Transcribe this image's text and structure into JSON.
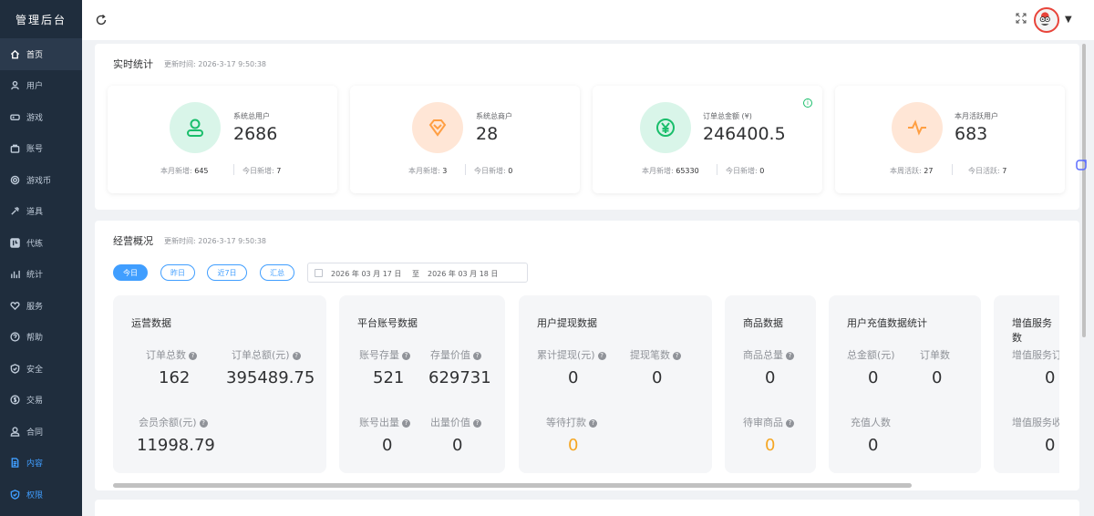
{
  "sidebar": {
    "logo": "管理后台",
    "items": [
      {
        "label": "首页",
        "icon": "home-icon"
      },
      {
        "label": "用户",
        "icon": "user-icon"
      },
      {
        "label": "游戏",
        "icon": "gamepad-icon"
      },
      {
        "label": "账号",
        "icon": "bag-icon"
      },
      {
        "label": "游戏币",
        "icon": "coin-icon"
      },
      {
        "label": "道具",
        "icon": "tool-icon"
      },
      {
        "label": "代练",
        "icon": "grid-icon"
      },
      {
        "label": "统计",
        "icon": "bar-chart-icon"
      },
      {
        "label": "服务",
        "icon": "heart-icon"
      },
      {
        "label": "帮助",
        "icon": "help-icon"
      },
      {
        "label": "安全",
        "icon": "shield-icon"
      },
      {
        "label": "交易",
        "icon": "dollar-icon"
      },
      {
        "label": "合同",
        "icon": "person-icon"
      },
      {
        "label": "内容",
        "icon": "document-icon"
      },
      {
        "label": "权限",
        "icon": "shield-check-icon"
      }
    ]
  },
  "realtime": {
    "title": "实时统计",
    "updated": "更新时间: 2026-3-17 9:50:38",
    "cards": [
      {
        "label": "系统总用户",
        "value": "2686",
        "foot1_label": "本月新增:",
        "foot1_value": "645",
        "foot2_label": "今日新增:",
        "foot2_value": "7",
        "icon": "user-icon",
        "color": "#19be6b"
      },
      {
        "label": "系统总商户",
        "value": "28",
        "foot1_label": "本月新增:",
        "foot1_value": "3",
        "foot2_label": "今日新增:",
        "foot2_value": "0",
        "icon": "diamond-icon",
        "color": "#ff9f43"
      },
      {
        "label": "订单总金额 (¥)",
        "value": "246400.5",
        "foot1_label": "本月新增:",
        "foot1_value": "65330",
        "foot2_label": "今日新增:",
        "foot2_value": "0",
        "icon": "yen-icon",
        "color": "#19be6b"
      },
      {
        "label": "本月活跃用户",
        "value": "683",
        "foot1_label": "本周活跃:",
        "foot1_value": "27",
        "foot2_label": "今日活跃:",
        "foot2_value": "7",
        "icon": "pulse-icon",
        "color": "#ff9f43"
      }
    ]
  },
  "business": {
    "title": "经营概况",
    "updated": "更新时间: 2026-3-17 9:50:38",
    "tabs": [
      "今日",
      "昨日",
      "近7日",
      "汇总"
    ],
    "date_start": "2026 年 03 月 17 日",
    "date_sep": "至",
    "date_end": "2026 年 03 月 18 日",
    "cards": [
      {
        "title": "运营数据",
        "items": [
          {
            "label": "订单总数",
            "value": "162",
            "help": true
          },
          {
            "label": "订单总额(元)",
            "value": "395489.75",
            "help": true
          },
          {
            "label": "会员余额(元)",
            "value": "11998.79",
            "help": true
          }
        ]
      },
      {
        "title": "平台账号数据",
        "items": [
          {
            "label": "账号存量",
            "value": "521",
            "help": true
          },
          {
            "label": "存量价值",
            "value": "629731",
            "help": true
          },
          {
            "label": "账号出量",
            "value": "0",
            "help": true
          },
          {
            "label": "出量价值",
            "value": "0",
            "help": true
          }
        ]
      },
      {
        "title": "用户提现数据",
        "items": [
          {
            "label": "累计提现(元)",
            "value": "0",
            "help": true
          },
          {
            "label": "提现笔数",
            "value": "0",
            "help": true
          },
          {
            "label": "等待打款",
            "value": "0",
            "help": true
          }
        ]
      },
      {
        "title": "商品数据",
        "items": [
          {
            "label": "商品总量",
            "value": "0",
            "help": true
          },
          {
            "label": "待审商品",
            "value": "0",
            "help": true
          }
        ]
      },
      {
        "title": "用户充值数据统计",
        "items": [
          {
            "label": "总金额(元)",
            "value": "0",
            "help": false
          },
          {
            "label": "订单数",
            "value": "0",
            "help": false
          },
          {
            "label": "充值人数",
            "value": "0",
            "help": false
          }
        ]
      },
      {
        "title": "增值服务数",
        "items": [
          {
            "label": "增值服务订",
            "value": "0",
            "help": false
          },
          {
            "label": "增值服务收",
            "value": "0",
            "help": false
          }
        ]
      }
    ]
  },
  "colors": {
    "accent": "#409eff",
    "sidebar": "#1f2d3d",
    "warning": "#f5a623"
  }
}
